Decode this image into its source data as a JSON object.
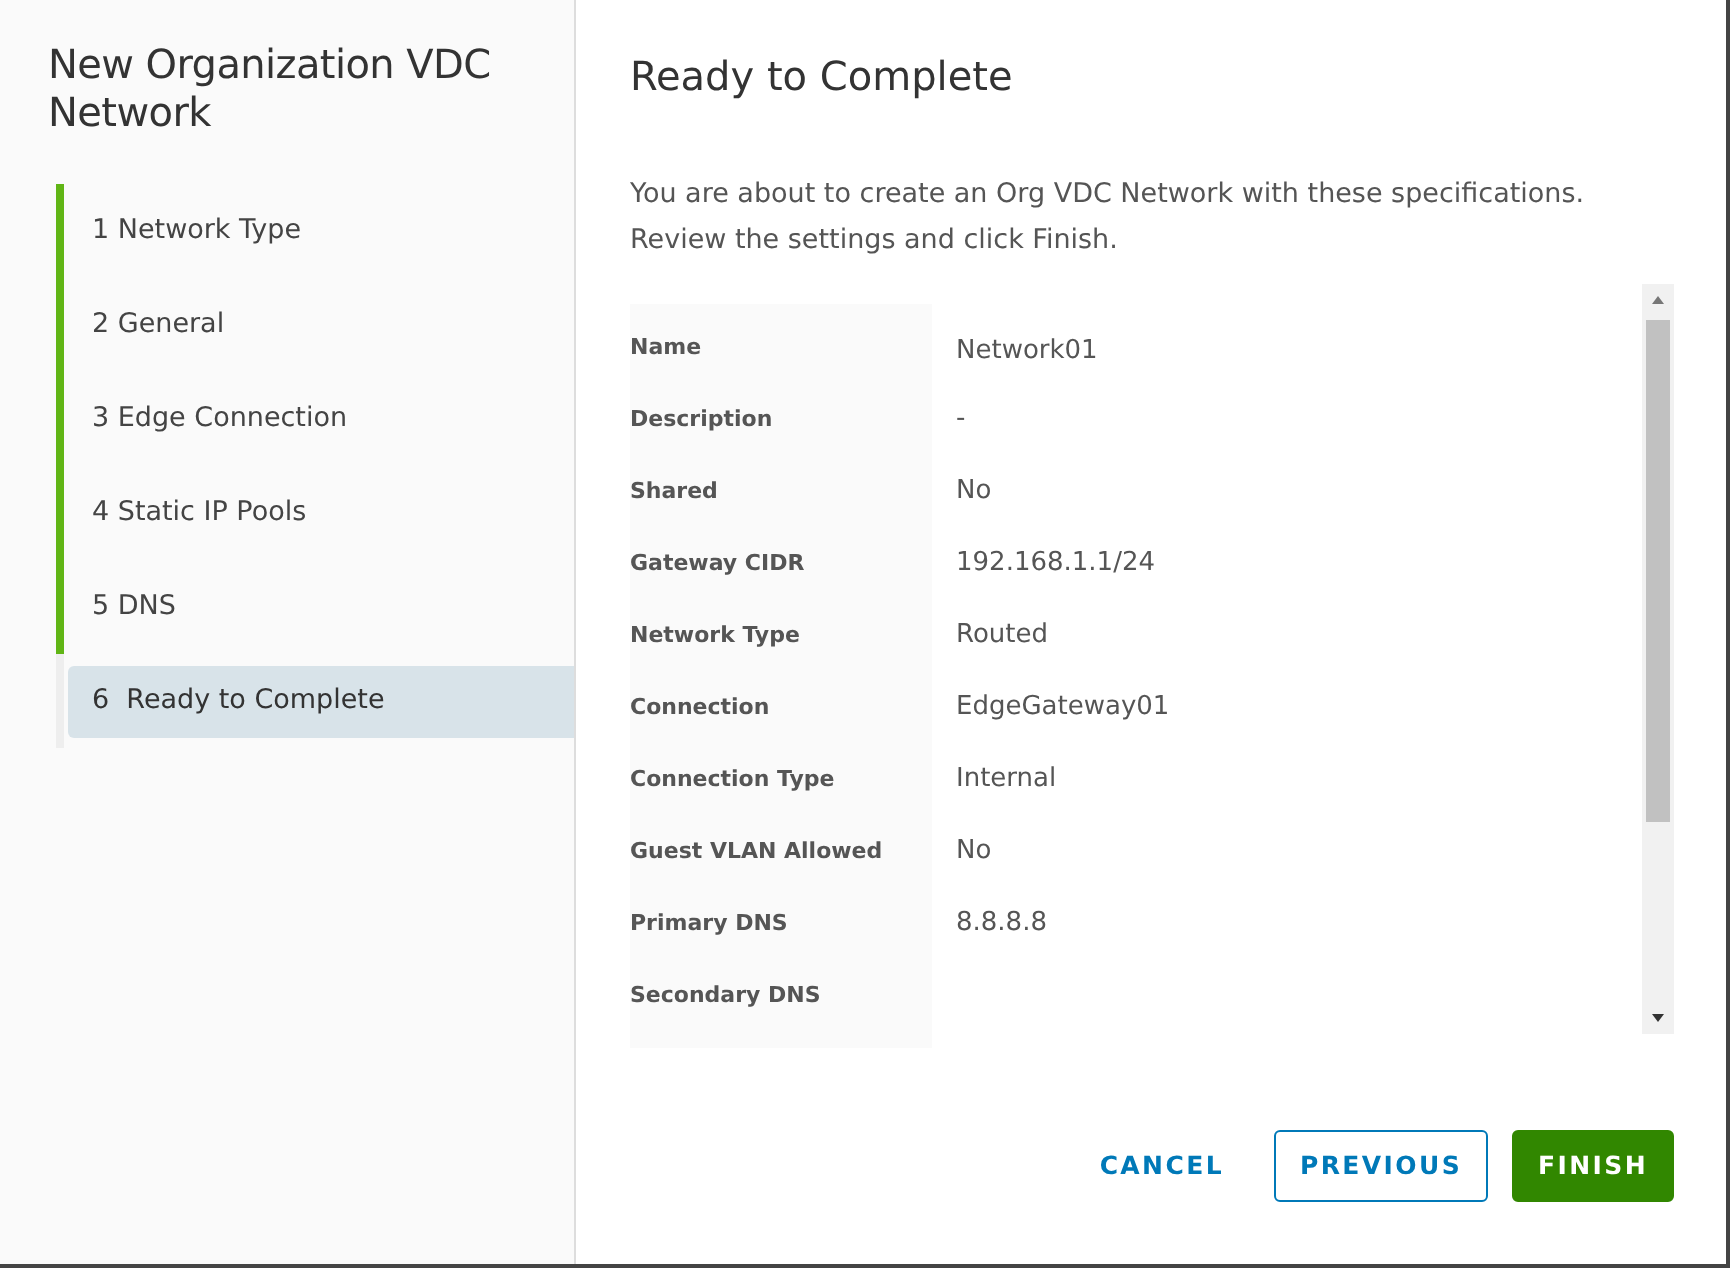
{
  "wizard": {
    "title": "New Organization VDC Network",
    "steps": [
      {
        "number": "1",
        "label": "Network Type",
        "completed": true,
        "selected": false
      },
      {
        "number": "2",
        "label": "General",
        "completed": true,
        "selected": false
      },
      {
        "number": "3",
        "label": "Edge Connection",
        "completed": true,
        "selected": false
      },
      {
        "number": "4",
        "label": "Static IP Pools",
        "completed": true,
        "selected": false
      },
      {
        "number": "5",
        "label": "DNS",
        "completed": true,
        "selected": false
      },
      {
        "number": "6",
        "label": "Ready to Complete",
        "completed": false,
        "selected": true
      }
    ]
  },
  "page": {
    "title": "Ready to Complete",
    "intro": [
      "You are about to create an Org VDC Network with these specifications.",
      "Review the settings and click Finish."
    ],
    "summary": [
      {
        "label": "Name",
        "value": "Network01"
      },
      {
        "label": "Description",
        "value": "-"
      },
      {
        "label": "Shared",
        "value": "No"
      },
      {
        "label": "Gateway CIDR",
        "value": "192.168.1.1/24"
      },
      {
        "label": "Network Type",
        "value": "Routed"
      },
      {
        "label": "Connection",
        "value": "EdgeGateway01"
      },
      {
        "label": "Connection Type",
        "value": "Internal"
      },
      {
        "label": "Guest VLAN Allowed",
        "value": "No"
      },
      {
        "label": "Primary DNS",
        "value": "8.8.8.8"
      },
      {
        "label": "Secondary DNS"
      }
    ]
  },
  "buttons": [
    {
      "kind": "link",
      "label": "CANCEL"
    },
    {
      "kind": "outline",
      "label": "PREVIOUS"
    },
    {
      "kind": "primary",
      "label": "FINISH"
    }
  ]
}
